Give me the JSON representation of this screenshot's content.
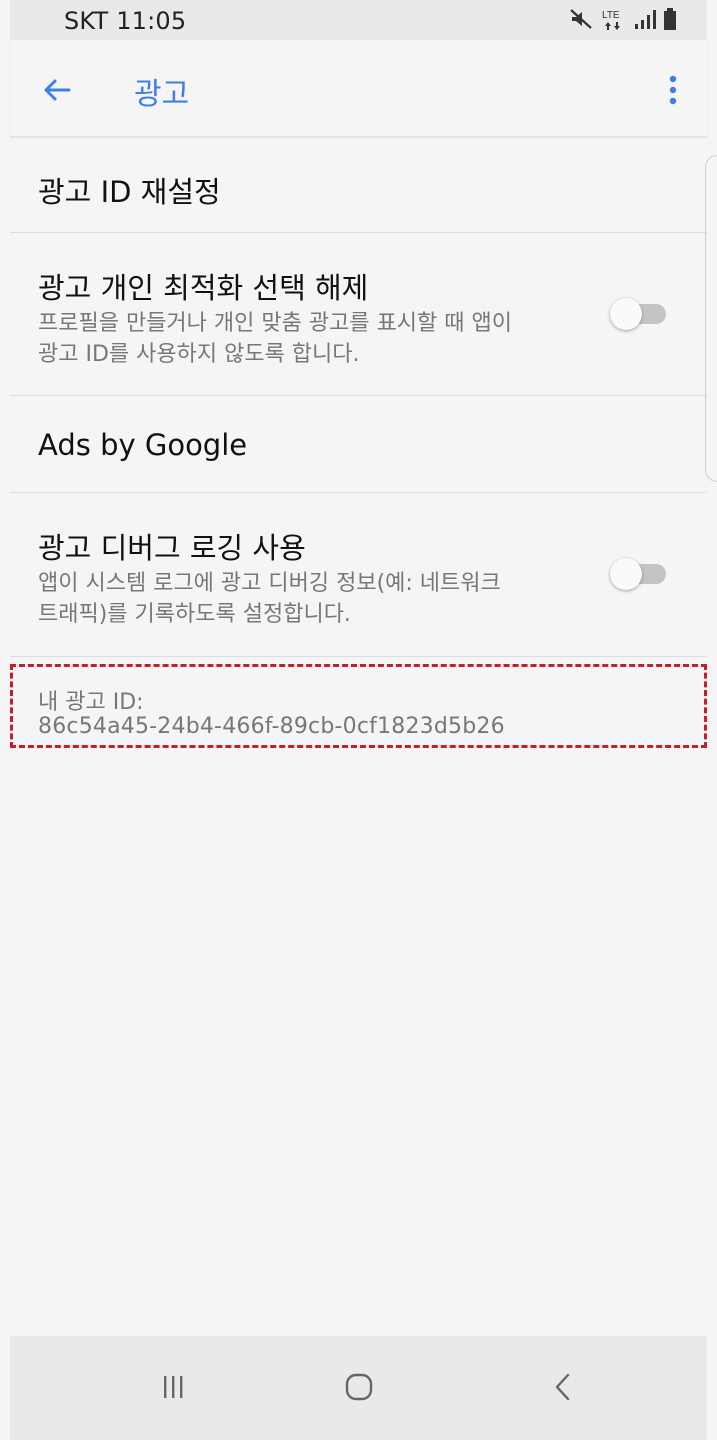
{
  "status_bar": {
    "carrier_time": "SKT 11:05",
    "icons": [
      "mute-icon",
      "lte-icon",
      "signal-icon",
      "battery-icon"
    ],
    "lte_label": "LTE"
  },
  "app_bar": {
    "title": "광고",
    "back_icon": "arrow-left-icon",
    "menu_icon": "more-vertical-icon",
    "accent_color": "#3f7ee8"
  },
  "settings": {
    "reset_ad_id": {
      "title": "광고 ID 재설정"
    },
    "opt_out_personalization": {
      "title": "광고 개인 최적화 선택 해제",
      "description_line1": "프로필을 만들거나 개인 맞춤 광고를 표시할 때 앱이",
      "description_line2": "광고 ID를 사용하지 않도록 합니다.",
      "enabled": false
    },
    "ads_by_google": {
      "title": "Ads by Google"
    },
    "debug_logging": {
      "title": "광고 디버그 로깅 사용",
      "description_line1": "앱이 시스템 로그에 광고 디버깅 정보(예: 네트워크",
      "description_line2": "트래픽)를 기록하도록 설정합니다.",
      "enabled": false
    }
  },
  "ad_id": {
    "label": "내 광고 ID:",
    "value": "86c54a45-24b4-466f-89cb-0cf1823d5b26",
    "highlight_color": "#c81e2c"
  },
  "nav_bar": {
    "buttons": [
      "recent-apps-icon",
      "home-icon",
      "back-icon"
    ]
  }
}
